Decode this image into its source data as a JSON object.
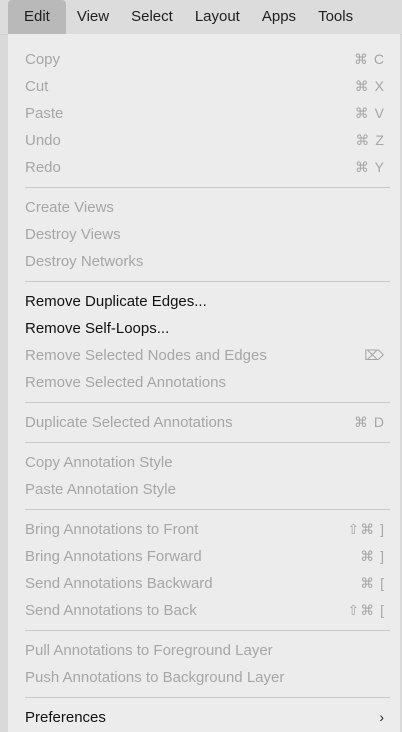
{
  "menubar": {
    "items": [
      "Edit",
      "View",
      "Select",
      "Layout",
      "Apps",
      "Tools"
    ]
  },
  "menu": {
    "groups": [
      [
        {
          "label": "Copy",
          "shortcut": "⌘ C",
          "enabled": false
        },
        {
          "label": "Cut",
          "shortcut": "⌘ X",
          "enabled": false
        },
        {
          "label": "Paste",
          "shortcut": "⌘ V",
          "enabled": false
        },
        {
          "label": "Undo",
          "shortcut": "⌘ Z",
          "enabled": false
        },
        {
          "label": "Redo",
          "shortcut": "⌘ Y",
          "enabled": false
        }
      ],
      [
        {
          "label": "Create Views",
          "shortcut": "",
          "enabled": false
        },
        {
          "label": "Destroy Views",
          "shortcut": "",
          "enabled": false
        },
        {
          "label": "Destroy Networks",
          "shortcut": "",
          "enabled": false
        }
      ],
      [
        {
          "label": "Remove Duplicate Edges...",
          "shortcut": "",
          "enabled": true
        },
        {
          "label": "Remove Self-Loops...",
          "shortcut": "",
          "enabled": true
        },
        {
          "label": "Remove Selected Nodes and Edges",
          "shortcut": "⌦",
          "enabled": false
        },
        {
          "label": "Remove Selected Annotations",
          "shortcut": "",
          "enabled": false
        }
      ],
      [
        {
          "label": "Duplicate Selected Annotations",
          "shortcut": "⌘ D",
          "enabled": false
        }
      ],
      [
        {
          "label": "Copy Annotation Style",
          "shortcut": "",
          "enabled": false
        },
        {
          "label": "Paste Annotation Style",
          "shortcut": "",
          "enabled": false
        }
      ],
      [
        {
          "label": "Bring Annotations to Front",
          "shortcut": "⇧⌘ ]",
          "enabled": false
        },
        {
          "label": "Bring Annotations Forward",
          "shortcut": "⌘ ]",
          "enabled": false
        },
        {
          "label": "Send Annotations Backward",
          "shortcut": "⌘ [",
          "enabled": false
        },
        {
          "label": "Send Annotations to Back",
          "shortcut": "⇧⌘ [",
          "enabled": false
        }
      ],
      [
        {
          "label": "Pull Annotations to Foreground Layer",
          "shortcut": "",
          "enabled": false
        },
        {
          "label": "Push Annotations to Background Layer",
          "shortcut": "",
          "enabled": false
        }
      ],
      [
        {
          "label": "Preferences",
          "shortcut": "›",
          "enabled": true,
          "submenu": true
        }
      ]
    ]
  }
}
